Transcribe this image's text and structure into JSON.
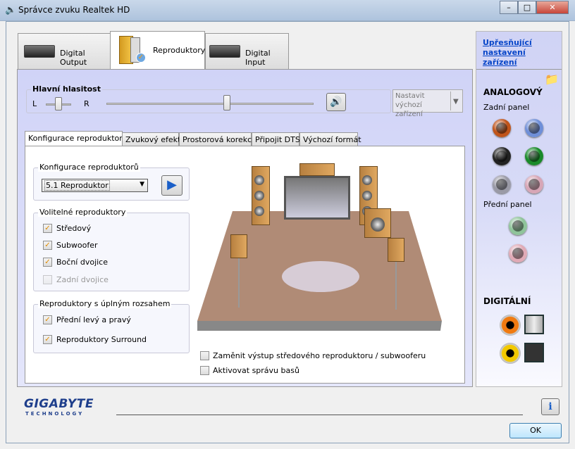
{
  "window": {
    "title": "Správce zvuku Realtek HD",
    "minimize": "–",
    "maximize": "□",
    "close": "✕"
  },
  "main_tabs": [
    {
      "label": "Digital Output"
    },
    {
      "label": "Reproduktory"
    },
    {
      "label": "Digital Input"
    }
  ],
  "volume": {
    "group_label": "Hlavní hlasitost",
    "left": "L",
    "right": "R",
    "balance": 0.5,
    "level": 0.58
  },
  "default_device": {
    "label": "Nastavit výchozí zařízení"
  },
  "sub_tabs": [
    {
      "label": "Konfigurace reproduktorů"
    },
    {
      "label": "Zvukový efekt"
    },
    {
      "label": "Prostorová korekce"
    },
    {
      "label": "Připojit DTS"
    },
    {
      "label": "Výchozí formát"
    }
  ],
  "config": {
    "group_label": "Konfigurace reproduktorů",
    "selected": "5.1 Reproduktor"
  },
  "optional": {
    "group_label": "Volitelné reproduktory",
    "items": [
      {
        "label": "Středový",
        "checked": true
      },
      {
        "label": "Subwoofer",
        "checked": true
      },
      {
        "label": "Boční dvojice",
        "checked": true
      },
      {
        "label": "Zadní dvojice",
        "checked": false,
        "disabled": true
      }
    ]
  },
  "fullrange": {
    "group_label": "Reproduktory s úplným rozsahem",
    "items": [
      {
        "label": "Přední levý a pravý",
        "checked": true
      },
      {
        "label": "Reproduktory Surround",
        "checked": true
      }
    ]
  },
  "options": [
    {
      "label": "Zaměnit výstup středového reproduktoru / subwooferu",
      "checked": false
    },
    {
      "label": "Aktivovat správu basů",
      "checked": false
    }
  ],
  "right": {
    "advanced_link": "Upřesňující nastavení zařízení",
    "analog": "ANALOGOVÝ",
    "rear_panel": "Zadní panel",
    "front_panel": "Přední panel",
    "digital": "DIGITÁLNÍ",
    "rear_jacks": [
      "#c0541a",
      "#6f8fd8",
      "#222222",
      "#1a8a2a",
      "#9a9aa6",
      "#d7a6b6"
    ],
    "front_jacks": [
      "#8fc49a",
      "#e0aab6"
    ]
  },
  "footer": {
    "brand": "GIGABYTE",
    "brand_sub": "TECHNOLOGY",
    "info": "i",
    "ok": "OK"
  }
}
